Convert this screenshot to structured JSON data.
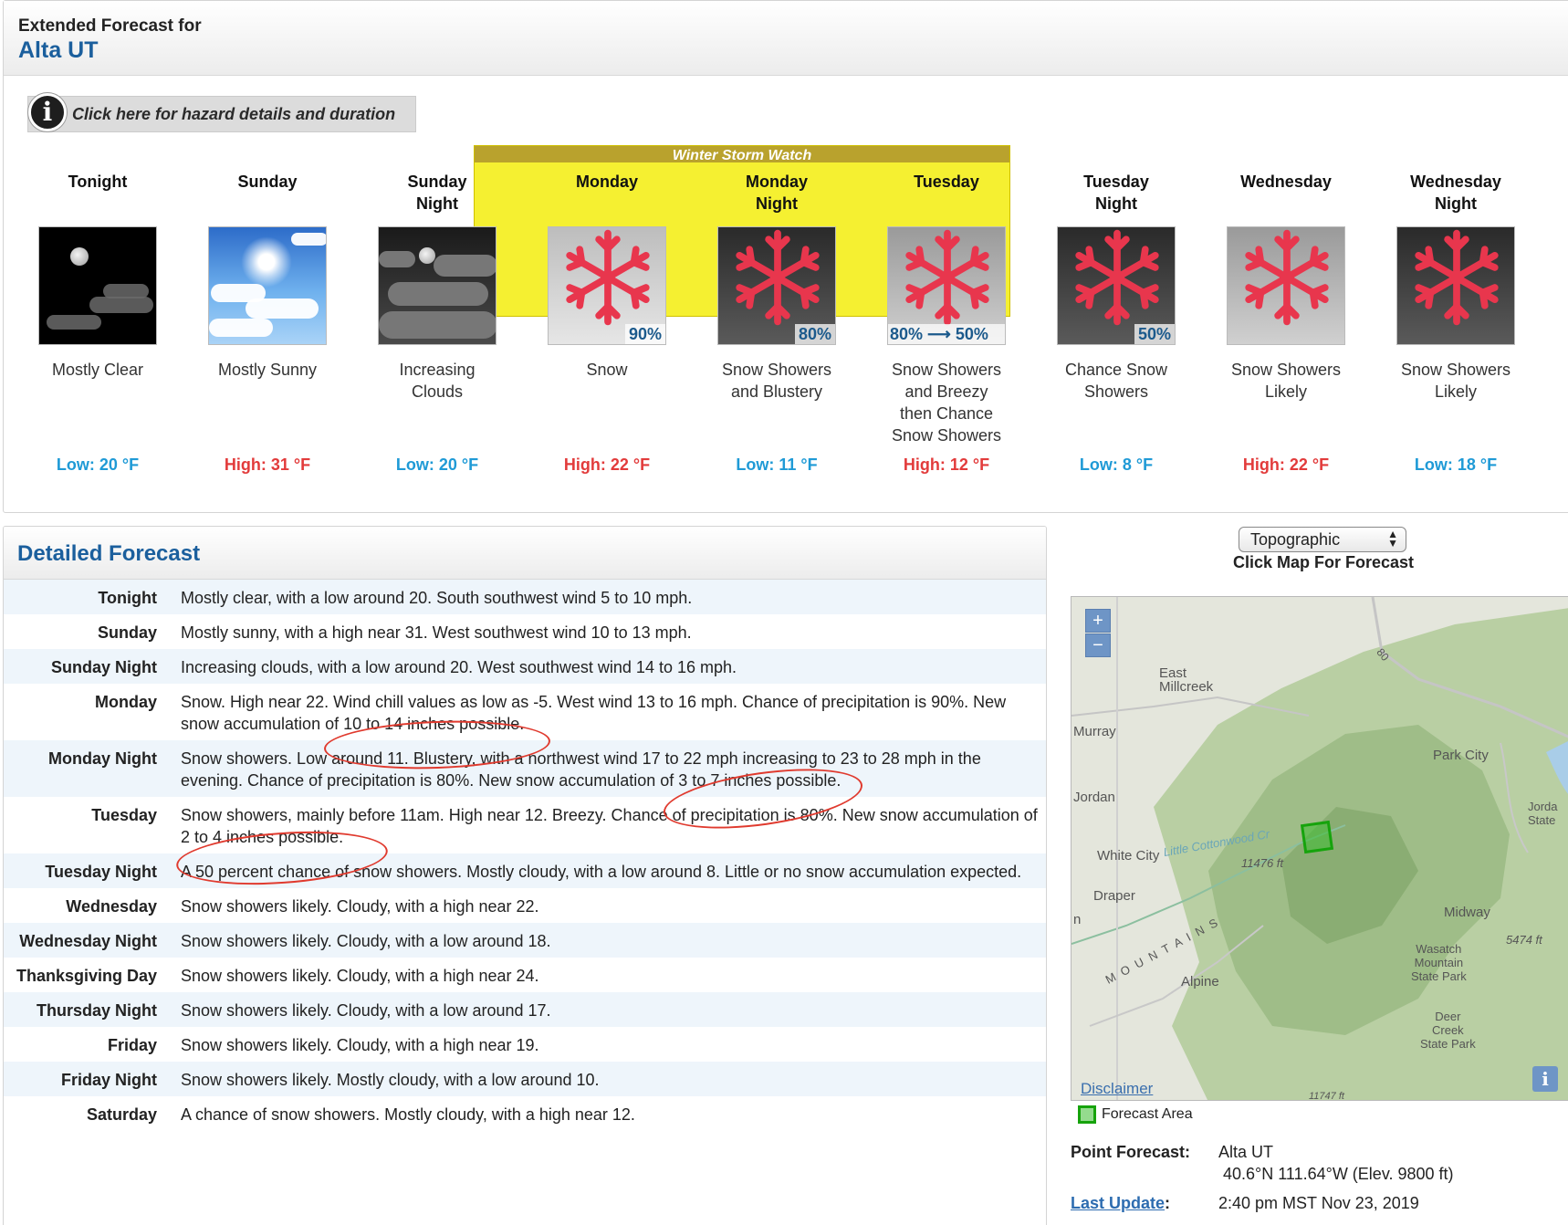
{
  "header": {
    "label": "Extended Forecast for",
    "location": "Alta UT"
  },
  "hazard": {
    "button_label": "Click here for hazard details and duration",
    "watch_label": "Winter Storm Watch"
  },
  "periods": [
    {
      "name": "Tonight",
      "desc": "Mostly Clear",
      "temp": "Low: 20 °F",
      "temp_kind": "low",
      "icon": "mostly-clear-night-icon"
    },
    {
      "name": "Sunday",
      "desc": "Mostly Sunny",
      "temp": "High: 31 °F",
      "temp_kind": "high",
      "icon": "mostly-sunny-icon"
    },
    {
      "name": "Sunday\nNight",
      "desc": "Increasing\nClouds",
      "temp": "Low: 20 °F",
      "temp_kind": "low",
      "icon": "increasing-clouds-night-icon"
    },
    {
      "name": "Monday",
      "desc": "Snow",
      "temp": "High: 22 °F",
      "temp_kind": "high",
      "icon": "snow-icon",
      "pop": "90%"
    },
    {
      "name": "Monday\nNight",
      "desc": "Snow Showers\nand Blustery",
      "temp": "Low: 11 °F",
      "temp_kind": "low",
      "icon": "snow-showers-icon",
      "pop": "80%"
    },
    {
      "name": "Tuesday",
      "desc": "Snow Showers\nand Breezy\nthen Chance\nSnow Showers",
      "temp": "High: 12 °F",
      "temp_kind": "high",
      "icon": "snow-showers-icon",
      "pop": "80% ⟶ 50%"
    },
    {
      "name": "Tuesday\nNight",
      "desc": "Chance Snow\nShowers",
      "temp": "Low: 8 °F",
      "temp_kind": "low",
      "icon": "chance-snow-showers-icon",
      "pop": "50%"
    },
    {
      "name": "Wednesday",
      "desc": "Snow Showers\nLikely",
      "temp": "High: 22 °F",
      "temp_kind": "high",
      "icon": "snow-showers-likely-icon"
    },
    {
      "name": "Wednesday\nNight",
      "desc": "Snow Showers\nLikely",
      "temp": "Low: 18 °F",
      "temp_kind": "low",
      "icon": "snow-showers-likely-icon"
    }
  ],
  "detailed": {
    "title": "Detailed Forecast",
    "rows": [
      {
        "label": "Tonight",
        "text": "Mostly clear, with a low around 20. South southwest wind 5 to 10 mph."
      },
      {
        "label": "Sunday",
        "text": "Mostly sunny, with a high near 31. West southwest wind 10 to 13 mph."
      },
      {
        "label": "Sunday Night",
        "text": "Increasing clouds, with a low around 20. West southwest wind 14 to 16 mph."
      },
      {
        "label": "Monday",
        "text": "Snow. High near 22. Wind chill values as low as -5. West wind 13 to 16 mph. Chance of precipitation is 90%. New snow accumulation of 10 to 14 inches possible."
      },
      {
        "label": "Monday Night",
        "text": "Snow showers. Low around 11. Blustery, with a northwest wind 17 to 22 mph increasing to 23 to 28 mph in the evening. Chance of precipitation is 80%. New snow accumulation of 3 to 7 inches possible."
      },
      {
        "label": "Tuesday",
        "text": "Snow showers, mainly before 11am. High near 12. Breezy. Chance of precipitation is 80%. New snow accumulation of 2 to 4 inches possible."
      },
      {
        "label": "Tuesday Night",
        "text": "A 50 percent chance of snow showers. Mostly cloudy, with a low around 8. Little or no snow accumulation expected."
      },
      {
        "label": "Wednesday",
        "text": "Snow showers likely. Cloudy, with a high near 22."
      },
      {
        "label": "Wednesday Night",
        "text": "Snow showers likely. Cloudy, with a low around 18."
      },
      {
        "label": "Thanksgiving Day",
        "text": "Snow showers likely. Cloudy, with a high near 24."
      },
      {
        "label": "Thursday Night",
        "text": "Snow showers likely. Cloudy, with a low around 17."
      },
      {
        "label": "Friday",
        "text": "Snow showers likely. Cloudy, with a high near 19."
      },
      {
        "label": "Friday Night",
        "text": "Snow showers likely. Mostly cloudy, with a low around 10."
      },
      {
        "label": "Saturday",
        "text": "A chance of snow showers. Mostly cloudy, with a high near 12."
      }
    ]
  },
  "map": {
    "select_value": "Topographic",
    "caption": "Click Map For Forecast",
    "zoom_in": "+",
    "zoom_out": "−",
    "disclaimer": "Disclaimer",
    "legend": "Forecast Area",
    "places": {
      "east_millcreek": "East\nMillcreek",
      "murray": "Murray",
      "jordan": "Jordan",
      "white_city": "White City",
      "draper": "Draper",
      "alpine": "Alpine",
      "park_city": "Park City",
      "midway": "Midway",
      "wasatch": "Wasatch\nMountain\nState Park",
      "deer_creek": "Deer\nCreek\nState Park",
      "jordanelle": "Jorda\nState",
      "little_cottonwood": "Little Cottonwood Cr",
      "elev1": "11476 ft",
      "elev2": "5474 ft",
      "elev3": "11747 ft",
      "mountains": "M O U N T A I N S",
      "road80": "80",
      "n": "n"
    }
  },
  "point_forecast": {
    "label": "Point Forecast:",
    "location": "Alta UT",
    "coords": "40.6°N 111.64°W (Elev. 9800 ft)",
    "last_update_label": "Last Update",
    "last_update_colon": ":",
    "last_update_value": "2:40 pm MST Nov 23, 2019"
  },
  "colors": {
    "accent": "#1b5f9d",
    "low": "#1f9ad6",
    "high": "#e23b3b",
    "watch": "#f5f031",
    "watch_bar": "#b9a22d",
    "forecast_area": "#16a30c"
  }
}
